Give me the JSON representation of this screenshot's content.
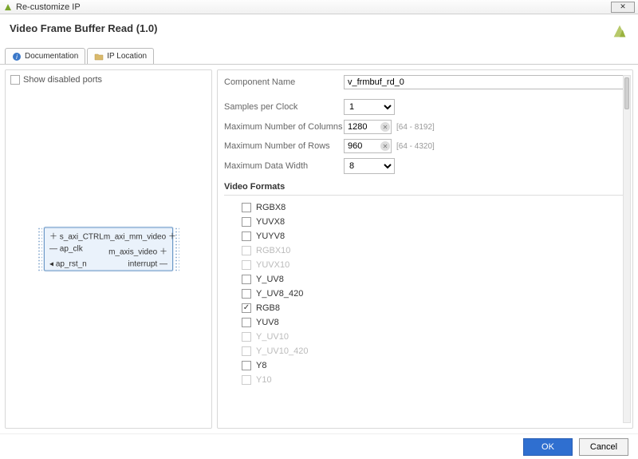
{
  "window": {
    "title": "Re-customize IP"
  },
  "header": {
    "title": "Video Frame Buffer Read (1.0)"
  },
  "tabs": {
    "documentation": "Documentation",
    "ip_location": "IP Location"
  },
  "left": {
    "show_disabled_ports": "Show disabled ports",
    "ports": {
      "p1l": "s_axi_CTRL",
      "p1r": "m_axi_mm_video",
      "p2l": "ap_clk",
      "p2r": "m_axis_video",
      "p3l": "ap_rst_n",
      "p3r": "interrupt"
    }
  },
  "form": {
    "component_name_label": "Component Name",
    "component_name_value": "v_frmbuf_rd_0",
    "samples_label": "Samples per Clock",
    "samples_value": "1",
    "max_cols_label": "Maximum Number of Columns",
    "max_cols_value": "1280",
    "max_cols_range": "[64 - 8192]",
    "max_rows_label": "Maximum Number of Rows",
    "max_rows_value": "960",
    "max_rows_range": "[64 - 4320]",
    "max_dw_label": "Maximum Data Width",
    "max_dw_value": "8",
    "video_formats_title": "Video Formats"
  },
  "video_formats": [
    {
      "label": "RGBX8",
      "checked": false,
      "disabled": false
    },
    {
      "label": "YUVX8",
      "checked": false,
      "disabled": false
    },
    {
      "label": "YUYV8",
      "checked": false,
      "disabled": false
    },
    {
      "label": "RGBX10",
      "checked": false,
      "disabled": true
    },
    {
      "label": "YUVX10",
      "checked": false,
      "disabled": true
    },
    {
      "label": "Y_UV8",
      "checked": false,
      "disabled": false
    },
    {
      "label": "Y_UV8_420",
      "checked": false,
      "disabled": false
    },
    {
      "label": "RGB8",
      "checked": true,
      "disabled": false
    },
    {
      "label": "YUV8",
      "checked": false,
      "disabled": false
    },
    {
      "label": "Y_UV10",
      "checked": false,
      "disabled": true
    },
    {
      "label": "Y_UV10_420",
      "checked": false,
      "disabled": true
    },
    {
      "label": "Y8",
      "checked": false,
      "disabled": false
    },
    {
      "label": "Y10",
      "checked": false,
      "disabled": true
    }
  ],
  "footer": {
    "ok": "OK",
    "cancel": "Cancel"
  }
}
